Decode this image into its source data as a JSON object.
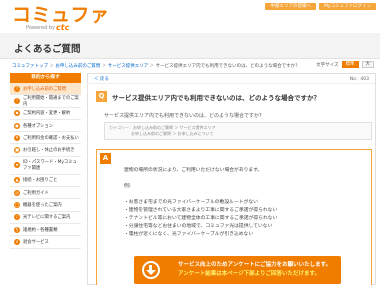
{
  "header": {
    "logo_main": "コミュファ",
    "logo_sub": "Powered by",
    "logo_brand": "ctc",
    "links": [
      "中部エリアの皆様へ",
      "Myコミュファログイン"
    ]
  },
  "page": {
    "title": "よくあるご質問"
  },
  "breadcrumb": {
    "items": [
      "コミュファトップ",
      "お申し込み前のご質問",
      "サービス提供エリア"
    ],
    "current": "サービス提供エリア内でも利用できないのは、どのような場合ですか？"
  },
  "font_size": {
    "label": "文字サイズ",
    "options": [
      "標準",
      "大"
    ]
  },
  "sidebar": {
    "header": "目的から探す",
    "items": [
      {
        "label": "お申し込み前のご質問",
        "icon": "?",
        "active": true
      },
      {
        "label": "ご利用開始・開通までのご案内",
        "icon": "!",
        "active": false
      },
      {
        "label": "ご契約内容・変更・解約",
        "icon": "◆",
        "active": false
      },
      {
        "label": "各種オプション",
        "icon": "●",
        "active": false
      },
      {
        "label": "ご利用料金の確認・お支払い",
        "icon": "¥",
        "active": false
      },
      {
        "label": "お引越し・休止のお手続き",
        "icon": "■",
        "active": false
      },
      {
        "label": "ID・パスワード・Myコミュファ関連",
        "icon": "★",
        "active": false
      },
      {
        "label": "接続・お困りごと",
        "icon": "▲",
        "active": false
      },
      {
        "label": "ご利用ガイド",
        "icon": "◎",
        "active": false
      },
      {
        "label": "機器を使ったご案内",
        "icon": "□",
        "active": false
      },
      {
        "label": "光テレビに関するご案内",
        "icon": "♪",
        "active": false
      },
      {
        "label": "諸規約・各種書類",
        "icon": "§",
        "active": false
      },
      {
        "label": "退会サービス",
        "icon": "×",
        "active": false
      }
    ]
  },
  "main": {
    "back": "＜ 戻る",
    "page_num": "No：403",
    "question_badge": "Q",
    "question": "サービス提供エリア内でも利用できないのは、どのような場合ですか？",
    "question_detail": "サービス提供エリア内でも利用できないのは、どのような場合ですか？",
    "category_label": "カテゴリー：",
    "category_line1": "お申し込み前のご質問 ＞ サービス提供エリア",
    "category_line2": "お申し込み前のご質問 ＞ お申し込みについて",
    "answer_badge": "A",
    "answer_lines": [
      "建物の場所の状況により、ご利用いただけない場合があります。",
      "",
      "例）",
      "",
      "・お客さま宅までの光ファイバーケーブルの敷設ルートがない",
      "・建物を管理されている大家さまより工事に関するご承諾が得られない",
      "・テナントビル等において建物全体の工事に関するご承諾が得られない",
      "・分譲住宅等などお住まいの地域で、コミュファ光は提供していない",
      "・電柱が近くになく、光ファイバーケーブルが引き込めない"
    ],
    "banner_line1": "サービス向上のためアンケートにご協力をお願いいたします。",
    "banner_line2": "アンケート結果は本ページ下部よりご回答いただけます。"
  },
  "colors": {
    "brand": "#f07d00",
    "accent_light": "#f6a53b",
    "active_bg": "#fde6c9",
    "link": "#0066cc"
  }
}
